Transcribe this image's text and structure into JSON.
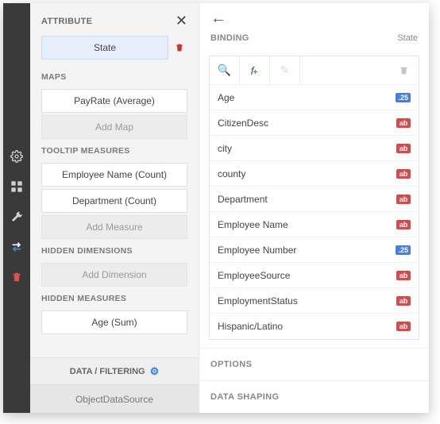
{
  "iconbar": {
    "tools": [
      "gear",
      "layout",
      "wrench",
      "swap",
      "trash"
    ]
  },
  "left": {
    "header": "ATTRIBUTE",
    "chip": "State",
    "sections": [
      {
        "title": "MAPS",
        "items": [
          {
            "label": "PayRate (Average)",
            "ghost": false
          },
          {
            "label": "Add Map",
            "ghost": true
          }
        ]
      },
      {
        "title": "TOOLTIP MEASURES",
        "items": [
          {
            "label": "Employee Name (Count)",
            "ghost": false
          },
          {
            "label": "Department (Count)",
            "ghost": false
          },
          {
            "label": "Add Measure",
            "ghost": true
          }
        ]
      },
      {
        "title": "HIDDEN DIMENSIONS",
        "items": [
          {
            "label": "Add Dimension",
            "ghost": true
          }
        ]
      },
      {
        "title": "HIDDEN MEASURES",
        "items": [
          {
            "label": "Age (Sum)",
            "ghost": false
          }
        ]
      }
    ],
    "dfLabel": "DATA / FILTERING",
    "dataSource": "ObjectDataSource"
  },
  "right": {
    "heading": "BINDING",
    "state": "State",
    "fields": [
      {
        "name": "Age",
        "type": "num",
        "badge": ".25"
      },
      {
        "name": "CitizenDesc",
        "type": "txt",
        "badge": "ab"
      },
      {
        "name": "city",
        "type": "txt",
        "badge": "ab"
      },
      {
        "name": "county",
        "type": "txt",
        "badge": "ab"
      },
      {
        "name": "Department",
        "type": "txt",
        "badge": "ab"
      },
      {
        "name": "Employee Name",
        "type": "txt",
        "badge": "ab"
      },
      {
        "name": "Employee Number",
        "type": "num",
        "badge": ".25"
      },
      {
        "name": "EmployeeSource",
        "type": "txt",
        "badge": "ab"
      },
      {
        "name": "EmploymentStatus",
        "type": "txt",
        "badge": "ab"
      },
      {
        "name": "Hispanic/Latino",
        "type": "txt",
        "badge": "ab"
      }
    ],
    "optionsLabel": "OPTIONS",
    "dataShapingLabel": "DATA SHAPING"
  }
}
